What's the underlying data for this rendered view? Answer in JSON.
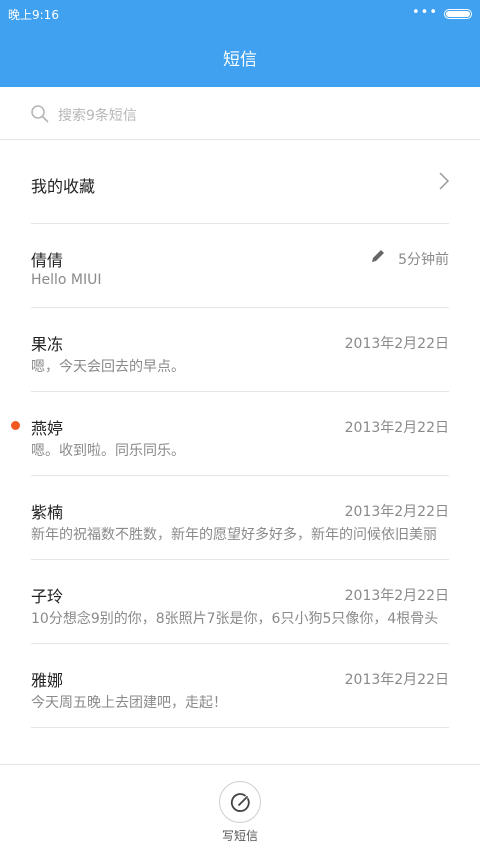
{
  "status_bar": {
    "time": "晚上9:16",
    "more": "•••"
  },
  "header": {
    "title": "短信"
  },
  "search": {
    "placeholder": "搜索9条短信"
  },
  "favorites": {
    "label": "我的收藏"
  },
  "conversations": [
    {
      "name": "倩倩",
      "preview": "Hello MIUI",
      "date": "5分钟前",
      "draft": true,
      "unread": false
    },
    {
      "name": "果冻",
      "preview": "嗯，今天会回去的早点。",
      "date": "2013年2月22日",
      "draft": false,
      "unread": false
    },
    {
      "name": "燕婷",
      "preview": "嗯。收到啦。同乐同乐。",
      "date": "2013年2月22日",
      "draft": false,
      "unread": true
    },
    {
      "name": "紫楠",
      "preview": "新年的祝福数不胜数，新年的愿望好多好多，新年的问候依旧美丽",
      "date": "2013年2月22日",
      "draft": false,
      "unread": false
    },
    {
      "name": "子玲",
      "preview": "10分想念9别的你，8张照片7张是你，6只小狗5只像你，4根骨头",
      "date": "2013年2月22日",
      "draft": false,
      "unread": false
    },
    {
      "name": "雅娜",
      "preview": "今天周五晚上去团建吧，走起！",
      "date": "2013年2月22日",
      "draft": false,
      "unread": false
    }
  ],
  "bottom": {
    "compose_label": "写短信"
  },
  "colors": {
    "header": "#3fa1ef",
    "unread_dot": "#f05a22",
    "divider": "#e6e6e6"
  },
  "icons": {
    "search": "search-icon",
    "chevron": "chevron-right-icon",
    "draft": "pencil-icon",
    "compose": "compose-icon"
  }
}
